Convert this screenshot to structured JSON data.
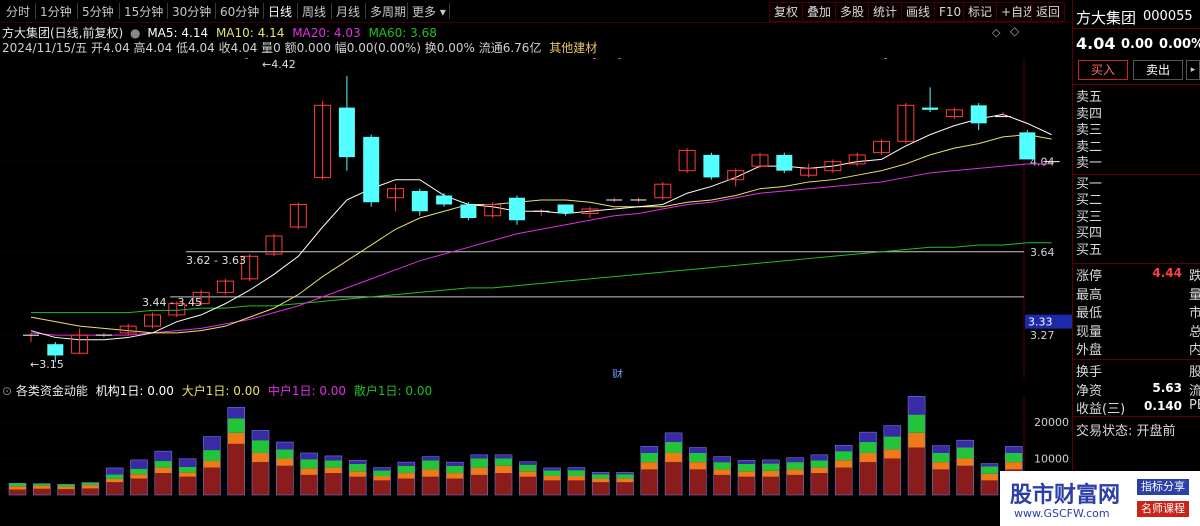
{
  "toolbar": {
    "periods": [
      "分时",
      "1分钟",
      "5分钟",
      "15分钟",
      "30分钟",
      "60分钟",
      "日线",
      "周线",
      "月线",
      "多周期",
      "更多"
    ],
    "active_period": "日线",
    "more_arrow": "▾",
    "right_buttons": [
      "复权",
      "叠加",
      "多股",
      "统计",
      "画线",
      "F10",
      "标记",
      "+自选",
      "返回"
    ]
  },
  "chart": {
    "title": "方大集团(日线,前复权)",
    "ma5": "MA5: 4.14",
    "ma10": "MA10: 4.14",
    "ma20": "MA20: 4.03",
    "ma60": "MA60: 3.68",
    "ohlc": "2024/11/15/五 开4.04 高4.04 低4.04 收4.04 量0 额0.000 幅0.00(0.00%) 换0.00% 流通6.76亿",
    "sector": "其他建材",
    "annotations": {
      "high": "4.42",
      "low": "3.15",
      "range1": "3.62 - 3.63",
      "range2": "3.44 - 3.45",
      "cai": "财"
    },
    "y_axis": [
      "4.04",
      "3.64",
      "3.27"
    ],
    "y_highlight": "3.33",
    "colors": {
      "up": "#ff3c3c",
      "down": "#54ffff",
      "ma5": "#ffffff",
      "ma10": "#e8e26a",
      "ma20": "#e030e0",
      "ma60": "#20c020"
    }
  },
  "indicator": {
    "title": "各类资金动能",
    "jigou": "机构1日: 0.00",
    "dahu": "大户1日: 0.00",
    "zhonghu": "中户1日: 0.00",
    "sanhu": "散户1日: 0.00",
    "y_axis": [
      "20000",
      "10000"
    ]
  },
  "panel": {
    "name": "方大集团",
    "code": "000055",
    "price": "4.04",
    "change": "0.00",
    "pct": "0.00%",
    "buy": "买入",
    "sell": "卖出",
    "orderbook": [
      "卖五",
      "卖四",
      "卖三",
      "卖二",
      "卖一",
      "买一",
      "买二",
      "买三",
      "买四",
      "买五"
    ],
    "stats": [
      {
        "label": "涨停",
        "value": "4.44",
        "extra": "跌"
      },
      {
        "label": "最高",
        "value": "",
        "extra": "量"
      },
      {
        "label": "最低",
        "value": "",
        "extra": "市"
      },
      {
        "label": "现量",
        "value": "",
        "extra": "总"
      },
      {
        "label": "外盘",
        "value": "",
        "extra": "内"
      }
    ],
    "stats2": [
      {
        "label": "换手",
        "value": "",
        "extra": "股"
      },
      {
        "label": "净资",
        "value": "5.63",
        "extra": "流"
      },
      {
        "label": "收益(三)",
        "value": "0.140",
        "extra": "PE"
      }
    ],
    "status": "交易状态: 开盘前"
  },
  "watermark": {
    "site": "股市财富网",
    "url": "www.GSCFW.com",
    "tag1": "指标分享",
    "tag2": "名师课程"
  },
  "chart_data": {
    "type": "candlestick",
    "candles": [
      [
        3.27,
        3.28,
        3.24,
        3.27
      ],
      [
        3.23,
        3.24,
        3.15,
        3.18
      ],
      [
        3.19,
        3.3,
        3.19,
        3.27
      ],
      [
        3.27,
        3.28,
        3.26,
        3.27
      ],
      [
        3.28,
        3.32,
        3.27,
        3.31
      ],
      [
        3.31,
        3.37,
        3.3,
        3.36
      ],
      [
        3.36,
        3.42,
        3.35,
        3.41
      ],
      [
        3.41,
        3.47,
        3.4,
        3.46
      ],
      [
        3.46,
        3.52,
        3.45,
        3.51
      ],
      [
        3.52,
        3.63,
        3.51,
        3.62
      ],
      [
        3.63,
        3.72,
        3.62,
        3.71
      ],
      [
        3.75,
        3.86,
        3.74,
        3.85
      ],
      [
        3.97,
        4.31,
        3.96,
        4.29
      ],
      [
        4.28,
        4.42,
        4.0,
        4.06
      ],
      [
        4.15,
        4.16,
        3.84,
        3.86
      ],
      [
        3.88,
        3.94,
        3.82,
        3.92
      ],
      [
        3.91,
        3.92,
        3.8,
        3.82
      ],
      [
        3.89,
        3.9,
        3.84,
        3.85
      ],
      [
        3.85,
        3.86,
        3.78,
        3.79
      ],
      [
        3.8,
        3.86,
        3.79,
        3.85
      ],
      [
        3.88,
        3.89,
        3.76,
        3.78
      ],
      [
        3.82,
        3.83,
        3.8,
        3.82
      ],
      [
        3.85,
        3.85,
        3.8,
        3.81
      ],
      [
        3.81,
        3.84,
        3.79,
        3.83
      ],
      [
        3.87,
        3.88,
        3.86,
        3.87
      ],
      [
        3.87,
        3.88,
        3.86,
        3.87
      ],
      [
        3.88,
        3.95,
        3.87,
        3.94
      ],
      [
        4.0,
        4.1,
        3.99,
        4.09
      ],
      [
        4.07,
        4.08,
        3.96,
        3.97
      ],
      [
        3.96,
        4.01,
        3.93,
        4.0
      ],
      [
        4.02,
        4.08,
        4.01,
        4.07
      ],
      [
        4.07,
        4.08,
        3.99,
        4.0
      ],
      [
        3.98,
        4.03,
        3.97,
        4.01
      ],
      [
        4.0,
        4.05,
        3.99,
        4.04
      ],
      [
        4.03,
        4.08,
        4.02,
        4.07
      ],
      [
        4.08,
        4.14,
        4.07,
        4.13
      ],
      [
        4.13,
        4.3,
        4.12,
        4.29
      ],
      [
        4.28,
        4.37,
        4.26,
        4.27
      ],
      [
        4.24,
        4.28,
        4.23,
        4.27
      ],
      [
        4.29,
        4.3,
        4.18,
        4.21
      ],
      [
        4.24,
        4.26,
        4.24,
        4.24
      ],
      [
        4.17,
        4.18,
        4.05,
        4.05
      ],
      [
        4.04,
        4.04,
        4.04,
        4.04
      ]
    ],
    "ma5": [
      3.29,
      3.26,
      3.25,
      3.25,
      3.26,
      3.28,
      3.33,
      3.36,
      3.41,
      3.47,
      3.54,
      3.62,
      3.75,
      3.87,
      3.92,
      3.96,
      3.96,
      3.89,
      3.85,
      3.84,
      3.82,
      3.82,
      3.81,
      3.82,
      3.83,
      3.84,
      3.85,
      3.9,
      3.93,
      3.97,
      4.02,
      4.02,
      4.01,
      4.02,
      4.04,
      4.05,
      4.11,
      4.16,
      4.2,
      4.23,
      4.25,
      4.21,
      4.16
    ],
    "ma10": [
      3.35,
      3.33,
      3.31,
      3.3,
      3.29,
      3.28,
      3.28,
      3.29,
      3.31,
      3.35,
      3.39,
      3.45,
      3.53,
      3.6,
      3.67,
      3.74,
      3.79,
      3.82,
      3.85,
      3.85,
      3.86,
      3.87,
      3.87,
      3.86,
      3.84,
      3.84,
      3.84,
      3.86,
      3.87,
      3.89,
      3.92,
      3.93,
      3.95,
      3.96,
      3.98,
      4.0,
      4.03,
      4.07,
      4.1,
      4.12,
      4.15,
      4.16,
      4.14
    ],
    "ma20": [
      3.28,
      3.27,
      3.27,
      3.27,
      3.27,
      3.28,
      3.29,
      3.3,
      3.32,
      3.34,
      3.37,
      3.4,
      3.44,
      3.48,
      3.52,
      3.56,
      3.6,
      3.63,
      3.66,
      3.69,
      3.72,
      3.74,
      3.76,
      3.78,
      3.8,
      3.81,
      3.83,
      3.85,
      3.86,
      3.88,
      3.9,
      3.91,
      3.92,
      3.93,
      3.94,
      3.95,
      3.97,
      3.99,
      4.0,
      4.01,
      4.02,
      4.03,
      4.03
    ],
    "ma60": [
      3.37,
      3.37,
      3.37,
      3.37,
      3.37,
      3.38,
      3.38,
      3.39,
      3.39,
      3.4,
      3.4,
      3.41,
      3.42,
      3.43,
      3.44,
      3.45,
      3.46,
      3.47,
      3.48,
      3.48,
      3.49,
      3.5,
      3.51,
      3.52,
      3.53,
      3.54,
      3.55,
      3.56,
      3.57,
      3.58,
      3.59,
      3.6,
      3.61,
      3.62,
      3.63,
      3.64,
      3.65,
      3.66,
      3.66,
      3.67,
      3.67,
      3.68,
      3.68
    ],
    "y_range": [
      3.08,
      4.5
    ],
    "h_levels": [
      3.64,
      3.44
    ],
    "funds": [
      [
        1500,
        800,
        900,
        0
      ],
      [
        1700,
        600,
        800,
        0
      ],
      [
        1600,
        600,
        700,
        0
      ],
      [
        1800,
        700,
        900,
        0
      ],
      [
        3500,
        1200,
        900,
        1800
      ],
      [
        4500,
        1500,
        1200,
        2400
      ],
      [
        6000,
        1800,
        1500,
        2700
      ],
      [
        5000,
        1500,
        1200,
        2200
      ],
      [
        7500,
        3000,
        1800,
        3700
      ],
      [
        14000,
        4000,
        3000,
        3000
      ],
      [
        9000,
        3500,
        2500,
        2700
      ],
      [
        8000,
        2500,
        2000,
        2000
      ],
      [
        5500,
        2500,
        1800,
        1700
      ],
      [
        6000,
        2000,
        1500,
        1200
      ],
      [
        5000,
        2000,
        1500,
        1000
      ],
      [
        4000,
        1500,
        1200,
        800
      ],
      [
        4500,
        2000,
        1500,
        1000
      ],
      [
        5000,
        2500,
        2000,
        1000
      ],
      [
        4500,
        2000,
        1500,
        1000
      ],
      [
        5500,
        2500,
        2000,
        1000
      ],
      [
        6000,
        2000,
        2000,
        1000
      ],
      [
        5000,
        1800,
        1500,
        800
      ],
      [
        4000,
        1500,
        1200,
        700
      ],
      [
        4000,
        1600,
        1200,
        700
      ],
      [
        3500,
        1200,
        1000,
        500
      ],
      [
        3500,
        1200,
        1000,
        500
      ],
      [
        7000,
        2500,
        2000,
        1800
      ],
      [
        9000,
        3000,
        2500,
        2500
      ],
      [
        7000,
        2500,
        2000,
        1500
      ],
      [
        5500,
        2000,
        1500,
        1500
      ],
      [
        5000,
        2000,
        1500,
        1000
      ],
      [
        5000,
        2000,
        1600,
        1000
      ],
      [
        5500,
        2000,
        1500,
        1200
      ],
      [
        6000,
        2000,
        1500,
        1500
      ],
      [
        7500,
        2500,
        2000,
        1600
      ],
      [
        9000,
        3000,
        2500,
        2700
      ],
      [
        10000,
        3500,
        2500,
        3000
      ],
      [
        13000,
        5000,
        4000,
        5000
      ],
      [
        7000,
        2500,
        2000,
        2000
      ],
      [
        8000,
        3000,
        2000,
        2000
      ],
      [
        4000,
        2000,
        1800,
        800
      ],
      [
        7000,
        2500,
        2000,
        1800
      ],
      [
        400,
        0,
        0,
        0
      ]
    ],
    "funds_max": 26000
  }
}
